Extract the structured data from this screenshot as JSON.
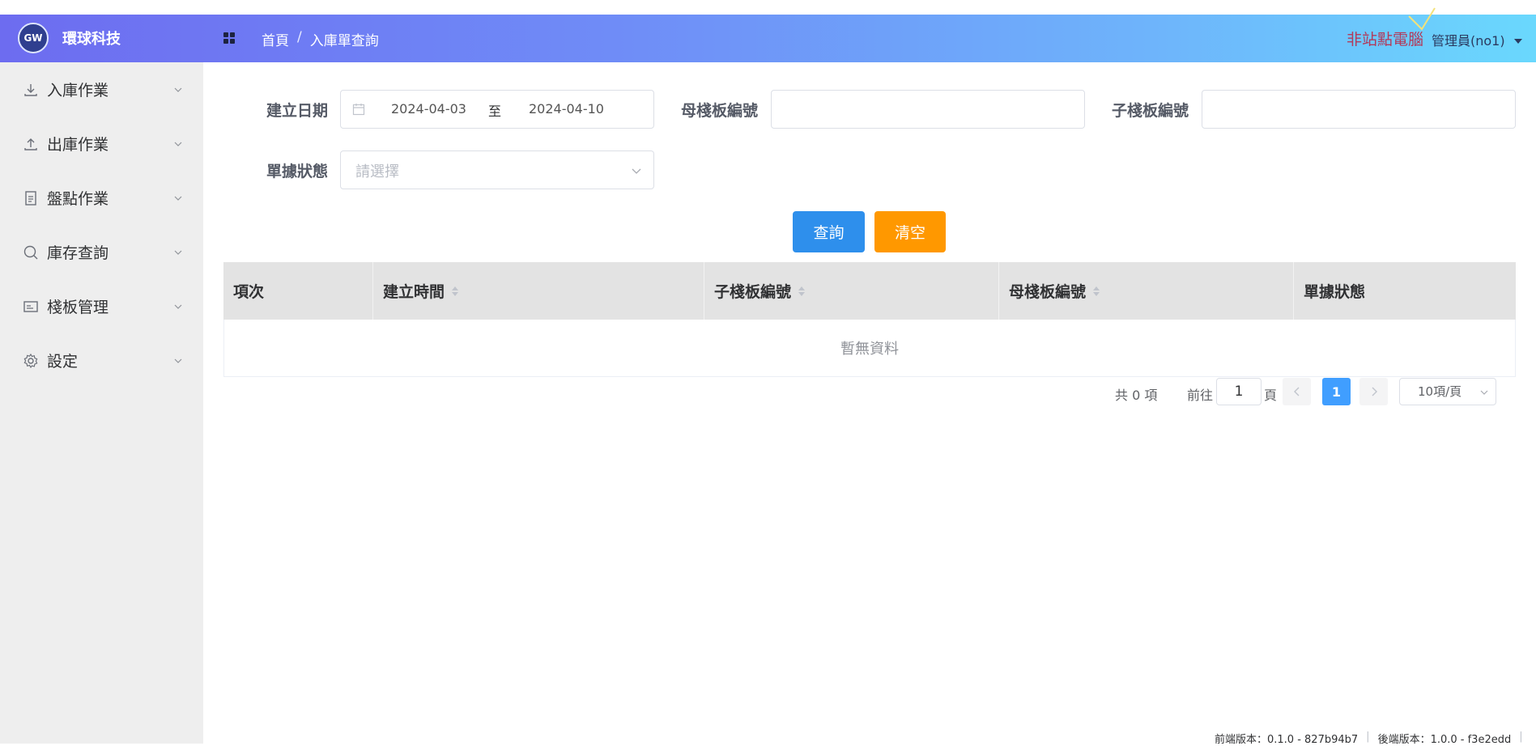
{
  "app": {
    "logo_text": "GW",
    "brand": "環球科技"
  },
  "header": {
    "breadcrumb": [
      "首頁",
      "入庫單查詢"
    ],
    "breadcrumb_sep": "/",
    "station": "非站點電腦",
    "user": "管理員(no1)"
  },
  "sidebar": {
    "items": [
      {
        "label": "入庫作業",
        "icon": "download-icon"
      },
      {
        "label": "出庫作業",
        "icon": "upload-icon"
      },
      {
        "label": "盤點作業",
        "icon": "document-icon"
      },
      {
        "label": "庫存查詢",
        "icon": "search-icon"
      },
      {
        "label": "棧板管理",
        "icon": "card-icon"
      },
      {
        "label": "設定",
        "icon": "gear-icon"
      }
    ]
  },
  "filters": {
    "create_date_label": "建立日期",
    "date_start": "2024-04-03",
    "date_to": "至",
    "date_end": "2024-04-10",
    "parent_pallet_label": "母棧板編號",
    "parent_pallet_value": "",
    "child_pallet_label": "子棧板編號",
    "child_pallet_value": "",
    "status_label": "單據狀態",
    "status_placeholder": "請選擇"
  },
  "actions": {
    "query": "查詢",
    "clear": "清空"
  },
  "table": {
    "columns": [
      "項次",
      "建立時間",
      "子棧板編號",
      "母棧板編號",
      "單據狀態"
    ],
    "empty_text": "暫無資料"
  },
  "pagination": {
    "total": "共 0 項",
    "goto_label": "前往",
    "goto_value": "1",
    "page_word": "頁",
    "current_page": "1",
    "page_size": "10項/頁"
  },
  "footer": {
    "frontend_version": "前端版本：0.1.0 - 827b94b7",
    "backend_version": "後端版本：1.0.0 - f3e2edd"
  },
  "colors": {
    "header_gradient_start": "#6d6cf0",
    "header_gradient_end": "#6ad8fd",
    "primary": "#2e8fec",
    "warning": "#ff9800",
    "sidebar_bg": "#eeeeee",
    "station_text": "#b23a5a"
  }
}
